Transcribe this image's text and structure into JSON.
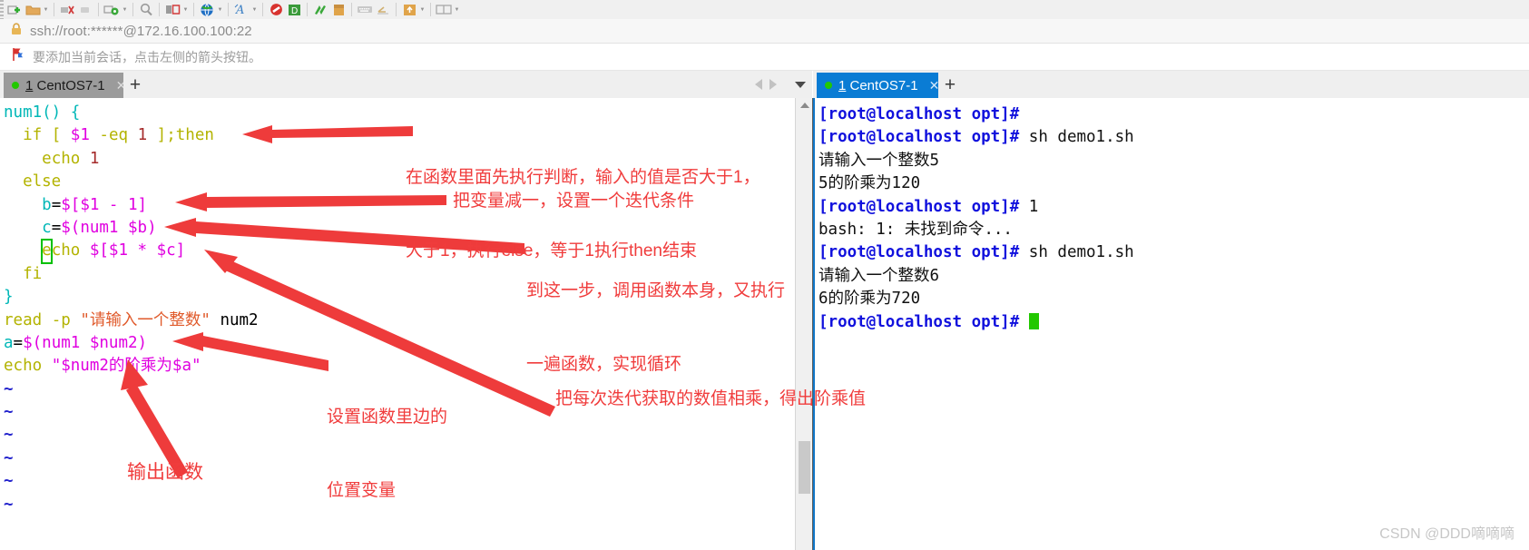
{
  "window": {
    "address": "ssh://root:******@172.16.100.100:22",
    "hint": "要添加当前会话，点击左侧的箭头按钮。",
    "watermark": "CSDN @DDD嘀嘀嘀"
  },
  "toolbar": {
    "icons": [
      {
        "name": "new-session-icon",
        "glyph": "new-session"
      },
      {
        "name": "open-folder-icon",
        "glyph": "folder"
      },
      {
        "name": "disconnect-icon",
        "glyph": "disconnect"
      },
      {
        "name": "reconnect-icon",
        "glyph": "reconnect"
      },
      {
        "name": "session-options-icon",
        "glyph": "session-options"
      },
      {
        "name": "find-icon",
        "glyph": "magnifier"
      },
      {
        "name": "layout-icon",
        "glyph": "layout"
      },
      {
        "name": "globe-icon",
        "glyph": "globe"
      },
      {
        "name": "font-icon",
        "glyph": "font-A"
      },
      {
        "name": "stop-icon",
        "glyph": "stop"
      },
      {
        "name": "log-icon",
        "glyph": "log-green"
      },
      {
        "name": "sync-icon",
        "glyph": "sync-arrows"
      },
      {
        "name": "transfer-icon",
        "glyph": "transfer"
      },
      {
        "name": "keyboard-icon",
        "glyph": "keyboard"
      },
      {
        "name": "clear-icon",
        "glyph": "clear-line"
      },
      {
        "name": "upload-icon",
        "glyph": "upload-box"
      },
      {
        "name": "tile-icon",
        "glyph": "tile-window"
      }
    ]
  },
  "tabs": {
    "left": {
      "label_prefix": "1",
      "label_text": " CentOS7-1",
      "close": "✕",
      "plus": "+"
    },
    "right": {
      "label_prefix": "1",
      "label_text": " CentOS7-1",
      "close": "✕",
      "plus": "+"
    }
  },
  "editor": {
    "lines": [
      {
        "id": "l1",
        "text": "num1() {"
      },
      {
        "id": "l2",
        "text": "  if [ $1 -eq 1 ];then"
      },
      {
        "id": "l3",
        "text": "    echo 1"
      },
      {
        "id": "l4",
        "text": "  else"
      },
      {
        "id": "l5",
        "text": "    b=$[$1 - 1]"
      },
      {
        "id": "l6",
        "text": "    c=$(num1 $b)"
      },
      {
        "id": "l7",
        "text": "    echo $[$1 * $c]"
      },
      {
        "id": "l8",
        "text": "  fi"
      },
      {
        "id": "l9",
        "text": "}"
      },
      {
        "id": "l10",
        "text": "read -p \"请输入一个整数\" num2"
      },
      {
        "id": "l11",
        "text": "a=$(num1 $num2)"
      },
      {
        "id": "l12",
        "text": "echo \"$num2的阶乘为$a\""
      },
      {
        "id": "l13",
        "text": "~"
      },
      {
        "id": "l14",
        "text": "~"
      },
      {
        "id": "l15",
        "text": "~"
      },
      {
        "id": "l16",
        "text": "~"
      },
      {
        "id": "l17",
        "text": "~"
      },
      {
        "id": "l18",
        "text": "~"
      }
    ],
    "tokens": {
      "fn_name": "num1() ",
      "brace_open": "{",
      "if_kw": "if",
      "bracket_l": "[",
      "dollar1": "$1",
      "eq": "-eq",
      "one": "1",
      "bracket_r": "]",
      "semi_then": ";then",
      "echo": "echo",
      "else": "else",
      "b_var": "b",
      "c_var": "c",
      "a_var": "a",
      "assign": "=",
      "sub_expr": "$[$1 - 1]",
      "call_expr": "$(num1 $b)",
      "mul_expr": "$[$1 * $c]",
      "fi": "fi",
      "brace_close": "}",
      "read": "read",
      "dash_p": "-p",
      "prompt_str": "\"请输入一个整数\"",
      "num2": "num2",
      "a_call": "$(num1 $num2)",
      "echo_str": "\"$num2的阶乘为$a\"",
      "cursor_char": "e",
      "cursor_rest": "cho $[$1 * $c]",
      "tilde": "~"
    }
  },
  "terminal": {
    "prompt": "[root@localhost opt]#",
    "lines": [
      {
        "type": "prompt",
        "prompt": "[root@localhost opt]#",
        "rest": ""
      },
      {
        "type": "prompt",
        "prompt": "[root@localhost opt]#",
        "rest": " sh demo1.sh"
      },
      {
        "type": "out",
        "text": "请输入一个整数5"
      },
      {
        "type": "out",
        "text": "5的阶乘为120"
      },
      {
        "type": "prompt",
        "prompt": "[root@localhost opt]#",
        "rest": " 1"
      },
      {
        "type": "out",
        "text": "bash: 1: 未找到命令..."
      },
      {
        "type": "prompt",
        "prompt": "[root@localhost opt]#",
        "rest": " sh demo1.sh"
      },
      {
        "type": "out",
        "text": "请输入一个整数6"
      },
      {
        "type": "out",
        "text": "6的阶乘为720"
      },
      {
        "type": "prompt-cursor",
        "prompt": "[root@localhost opt]#",
        "rest": " "
      }
    ]
  },
  "annotations": [
    {
      "id": "a1",
      "line1": "在函数里面先执行判断，输入的值是否大于1，",
      "line2": "大于1，执行else，等于1执行then结束"
    },
    {
      "id": "a2",
      "text": "把变量减一，设置一个迭代条件"
    },
    {
      "id": "a3",
      "line1": "到这一步，调用函数本身，又执行",
      "line2": "一遍函数，实现循环"
    },
    {
      "id": "a4",
      "line1": "设置函数里边的",
      "line2": "位置变量"
    },
    {
      "id": "a5",
      "text": "把每次迭代获取的数值相乘，得出阶乘值"
    },
    {
      "id": "a6",
      "text": "输出函数"
    }
  ],
  "colors": {
    "annotation_red": "#f03c3c",
    "tab_active_blue": "#0a7cd4",
    "prompt_blue": "#1111dd",
    "cursor_green": "#22c800",
    "string_orange": "#e05a2b",
    "var_magenta": "#e000e0",
    "keyword_yellow": "#b3b300",
    "cyan": "#00b7b7"
  }
}
